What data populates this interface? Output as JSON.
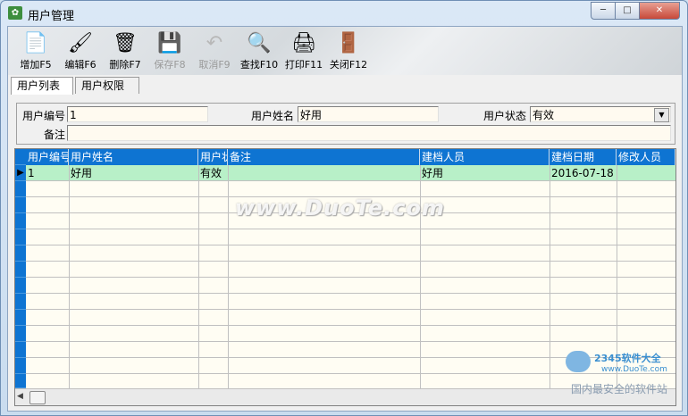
{
  "window": {
    "title": "用户管理",
    "minimize": "─",
    "maximize": "□",
    "close": "✕"
  },
  "toolbar": {
    "buttons": [
      {
        "label": "增加F5",
        "icon": "add-doc-icon",
        "glyph": "📄",
        "enabled": true
      },
      {
        "label": "编辑F6",
        "icon": "edit-brush-icon",
        "glyph": "🖌",
        "enabled": true
      },
      {
        "label": "删除F7",
        "icon": "trash-icon",
        "glyph": "🗑",
        "enabled": true
      },
      {
        "label": "保存F8",
        "icon": "save-icon",
        "glyph": "💾",
        "enabled": false
      },
      {
        "label": "取消F9",
        "icon": "undo-icon",
        "glyph": "↶",
        "enabled": false
      },
      {
        "label": "查找F10",
        "icon": "search-person-icon",
        "glyph": "🔍",
        "enabled": true
      },
      {
        "label": "打印F11",
        "icon": "printer-icon",
        "glyph": "🖨",
        "enabled": true
      },
      {
        "label": "关闭F12",
        "icon": "exit-door-icon",
        "glyph": "🚪",
        "enabled": true
      }
    ]
  },
  "tabs": [
    {
      "label": "用户列表",
      "active": true
    },
    {
      "label": "用户权限",
      "active": false
    }
  ],
  "form": {
    "user_id_label": "用户编号",
    "user_id_value": "1",
    "user_name_label": "用户姓名",
    "user_name_value": "好用",
    "user_status_label": "用户状态",
    "user_status_value": "有效",
    "remark_label": "备注",
    "remark_value": ""
  },
  "grid": {
    "columns": [
      "用户编号",
      "用户姓名",
      "用户状态",
      "备注",
      "建档人员",
      "建档日期",
      "修改人员"
    ],
    "rows": [
      [
        "1",
        "好用",
        "有效",
        "",
        "好用",
        "2016-07-18",
        ""
      ]
    ],
    "current_row_marker": "▶"
  },
  "scrollbar": {
    "left_arrow": "◀"
  },
  "watermark": {
    "text": "www.DuoTe.com"
  },
  "corner_badge": {
    "brand": "2345软件大全",
    "url": "www.DuoTe.com",
    "slogan": "国内最安全的软件站"
  }
}
